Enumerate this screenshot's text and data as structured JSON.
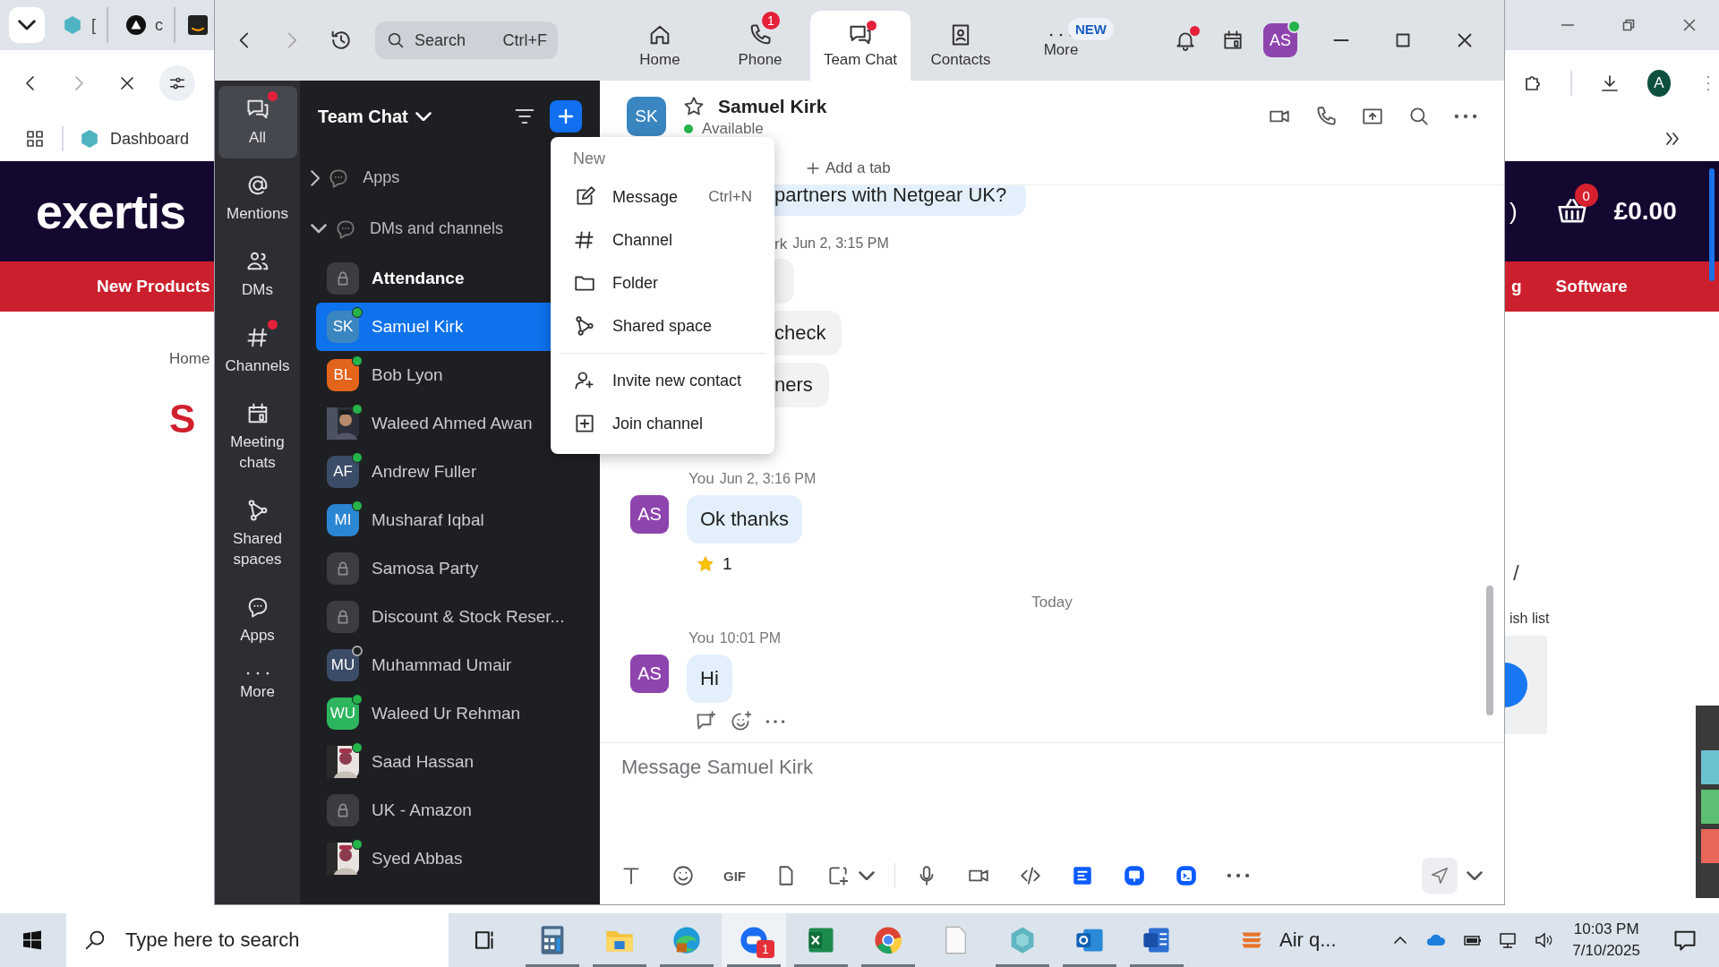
{
  "browser": {
    "tabs": [
      {
        "label": "["
      },
      {
        "label": "c"
      }
    ],
    "bookmark": "Dashboard",
    "profile_initial": "A"
  },
  "website": {
    "logo": "exertis",
    "nav_left": "New Products",
    "nav_right_partial": "g",
    "nav_right": "Software",
    "cart_partial": ")",
    "cart_count": "0",
    "cart_total": "£0.00",
    "breadcrumb": "Home",
    "heading_partial": "S",
    "side_partial": "/",
    "wishlist_partial": "ish list"
  },
  "zoom_window": {
    "title_bar": {
      "search": {
        "placeholder": "Search",
        "shortcut": "Ctrl+F"
      },
      "tabs": [
        {
          "label": "Home",
          "selected": false,
          "unread": false
        },
        {
          "label": "Phone",
          "selected": false,
          "unread": false,
          "badge": "1"
        },
        {
          "label": "Team Chat",
          "selected": true,
          "unread": true
        },
        {
          "label": "Contacts",
          "selected": false,
          "unread": false
        },
        {
          "label": "More",
          "selected": false,
          "unread": false,
          "tag": "NEW"
        }
      ],
      "notifications_unread": true,
      "avatar": "AS",
      "avatar_online": true
    },
    "rail": [
      {
        "label": "All",
        "selected": true,
        "unread": true
      },
      {
        "label": "Mentions",
        "selected": false,
        "unread": false
      },
      {
        "label": "DMs",
        "selected": false,
        "unread": false
      },
      {
        "label": "Channels",
        "selected": false,
        "unread": true
      },
      {
        "label": "Meeting chats",
        "selected": false,
        "unread": false
      },
      {
        "label": "Shared spaces",
        "selected": false,
        "unread": false
      },
      {
        "label": "Apps",
        "selected": false,
        "unread": false
      },
      {
        "label": "More",
        "selected": false,
        "unread": false
      }
    ],
    "channel_list": {
      "title": "Team Chat",
      "sections": [
        {
          "label": "Apps",
          "expanded": false
        },
        {
          "label": "DMs and channels",
          "expanded": true
        }
      ],
      "items": [
        {
          "name": "Attendance",
          "kind": "channel",
          "unread": true,
          "selected": false
        },
        {
          "name": "Samuel Kirk",
          "kind": "initials",
          "initials": "SK",
          "color": "#3a86c0",
          "online": true,
          "unread": false,
          "selected": true
        },
        {
          "name": "Bob Lyon",
          "kind": "initials",
          "initials": "BL",
          "color": "#e3641b",
          "online": true,
          "unread": false,
          "selected": false
        },
        {
          "name": "Waleed Ahmed Awan",
          "online": true,
          "unread": false,
          "selected": false
        },
        {
          "name": "Andrew Fuller",
          "kind": "initials",
          "initials": "AF",
          "color": "#3b4c68",
          "online": true,
          "unread": false,
          "selected": false
        },
        {
          "name": "Musharaf Iqbal",
          "kind": "initials",
          "initials": "MI",
          "color": "#2b86d4",
          "online": true,
          "unread": false,
          "selected": false
        },
        {
          "name": "Samosa Party",
          "kind": "channel",
          "unread": false,
          "selected": false
        },
        {
          "name": "Discount & Stock Reser...",
          "kind": "channel",
          "unread": false,
          "selected": false
        },
        {
          "name": "Muhammad Umair",
          "kind": "initials",
          "initials": "MU",
          "color": "#3b4c68",
          "online": false,
          "unread": false,
          "selected": false
        },
        {
          "name": "Waleed Ur Rehman",
          "kind": "initials",
          "initials": "WU",
          "color": "#2db55d",
          "online": true,
          "unread": false,
          "selected": false
        },
        {
          "name": "Saad Hassan",
          "online": true,
          "unread": false,
          "selected": false
        },
        {
          "name": "UK - Amazon",
          "kind": "channel",
          "unread": false,
          "selected": false
        },
        {
          "name": "Syed Abbas",
          "online": true,
          "unread": false,
          "selected": false
        }
      ]
    },
    "chat": {
      "contact": {
        "initials": "SK",
        "name": "Samuel Kirk",
        "status": "Available",
        "favorite": false
      },
      "add_tab": "Add a tab",
      "messages": [
        {
          "kind": "partial_bubble",
          "text": "partners with Netgear UK?",
          "mine": true
        },
        {
          "kind": "partial_meta",
          "sender": "rk",
          "time": "Jun 2, 3:15 PM"
        },
        {
          "kind": "bubble_edge",
          "mine": false
        },
        {
          "kind": "partial_bubble",
          "text": "check",
          "mine": false
        },
        {
          "kind": "partial_bubble",
          "text": "ners",
          "mine": false
        },
        {
          "kind": "message",
          "sender": "You",
          "time": "Jun 2, 3:16 PM",
          "avatar": "AS",
          "text": "Ok thanks",
          "mine": true,
          "reaction_count": "1"
        },
        {
          "kind": "date_divider",
          "text": "Today"
        },
        {
          "kind": "message",
          "sender": "You",
          "time": "10:01 PM",
          "avatar": "AS",
          "text": "Hi",
          "mine": true,
          "hovered": true
        }
      ],
      "composer": {
        "placeholder": "Message Samuel Kirk",
        "gif_label": "GIF"
      }
    },
    "new_menu": {
      "header": "New",
      "groups": [
        [
          {
            "label": "Message",
            "shortcut": "Ctrl+N"
          },
          {
            "label": "Channel"
          },
          {
            "label": "Folder"
          },
          {
            "label": "Shared space"
          }
        ],
        [
          {
            "label": "Invite new contact"
          },
          {
            "label": "Join channel"
          }
        ]
      ]
    }
  },
  "taskbar": {
    "search": {
      "placeholder": "Type here to search"
    },
    "apps": [
      {
        "running": true,
        "selected": false
      },
      {
        "running": true,
        "selected": false
      },
      {
        "running": true,
        "selected": false
      },
      {
        "running": true,
        "selected": true,
        "badge": "1"
      },
      {
        "running": true,
        "selected": false
      },
      {
        "running": true,
        "selected": false
      },
      {
        "running": false,
        "selected": false
      },
      {
        "running": true,
        "selected": false
      },
      {
        "running": true,
        "selected": false
      },
      {
        "running": true,
        "selected": false
      }
    ],
    "weather": "Air q...",
    "time": "10:03 PM",
    "date": "7/10/2025"
  }
}
